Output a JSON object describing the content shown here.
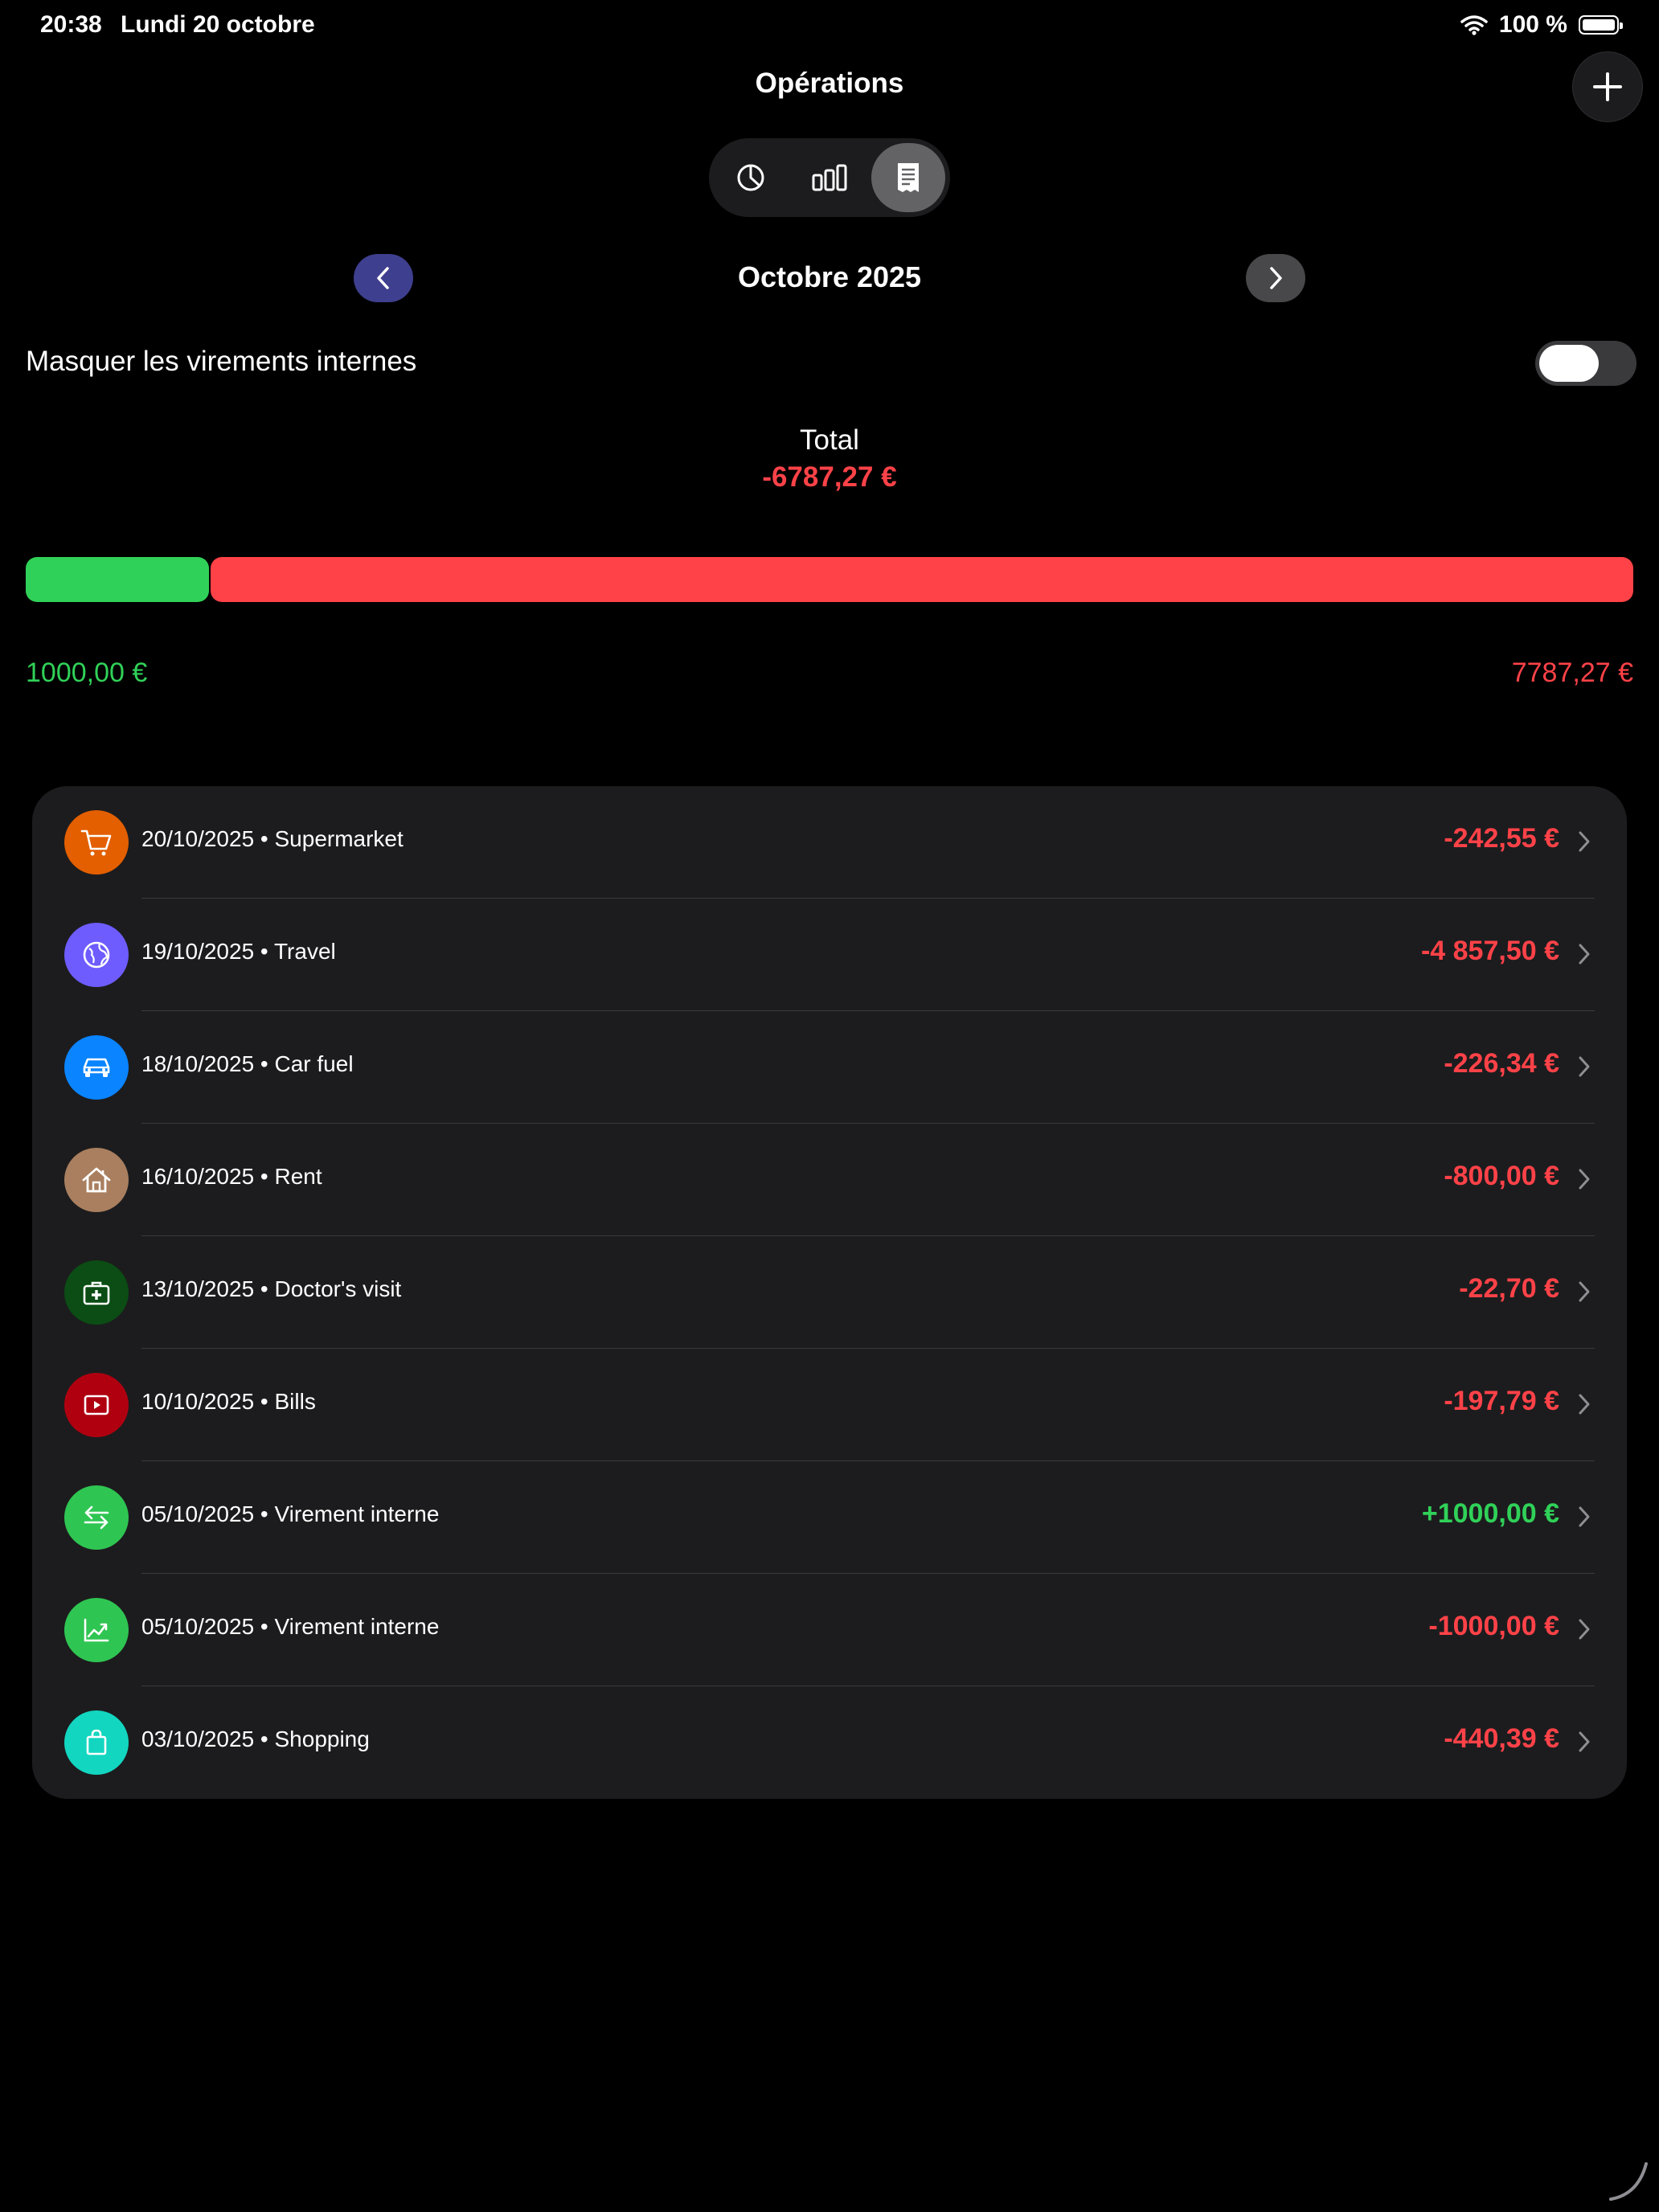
{
  "status_bar": {
    "time": "20:38",
    "date": "Lundi 20 octobre",
    "battery": "100 %"
  },
  "header": {
    "title": "Opérations"
  },
  "view_switcher": {
    "options": [
      "pie-chart-icon",
      "bar-chart-icon",
      "list-receipt-icon"
    ],
    "selected": "list-receipt-icon"
  },
  "month_nav": {
    "label": "Octobre 2025"
  },
  "filter": {
    "label": "Masquer les virements internes",
    "enabled": false
  },
  "summary": {
    "total_label": "Total",
    "total_value": "-6787,27 €",
    "income": "1000,00 €",
    "expense": "7787,27 €",
    "income_fraction": 0.114
  },
  "transactions": [
    {
      "label": "20/10/2025 • Supermarket",
      "amount": "-242,55 €",
      "sign": "neg",
      "icon": "cart-icon",
      "color": "#e35f00"
    },
    {
      "label": "19/10/2025 • Travel",
      "amount": "-4 857,50 €",
      "sign": "neg",
      "icon": "globe-icon",
      "color": "#6e5cff"
    },
    {
      "label": "18/10/2025 • Car fuel",
      "amount": "-226,34 €",
      "sign": "neg",
      "icon": "car-icon",
      "color": "#0a84ff"
    },
    {
      "label": "16/10/2025 • Rent",
      "amount": "-800,00 €",
      "sign": "neg",
      "icon": "house-icon",
      "color": "#a97f5f"
    },
    {
      "label": "13/10/2025 • Doctor's visit",
      "amount": "-22,70 €",
      "sign": "neg",
      "icon": "medical-bag-icon",
      "color": "#0b4d14"
    },
    {
      "label": "10/10/2025 • Bills",
      "amount": "-197,79 €",
      "sign": "neg",
      "icon": "play-screen-icon",
      "color": "#b00010"
    },
    {
      "label": "05/10/2025 • Virement interne",
      "amount": "+1000,00 €",
      "sign": "pos",
      "icon": "transfer-arrows-icon",
      "color": "#2fc552"
    },
    {
      "label": "05/10/2025 • Virement interne",
      "amount": "-1000,00 €",
      "sign": "neg",
      "icon": "trend-chart-icon",
      "color": "#2fc552"
    },
    {
      "label": "03/10/2025 • Shopping",
      "amount": "-440,39 €",
      "sign": "neg",
      "icon": "shopping-bag-icon",
      "color": "#12d6c0"
    }
  ]
}
